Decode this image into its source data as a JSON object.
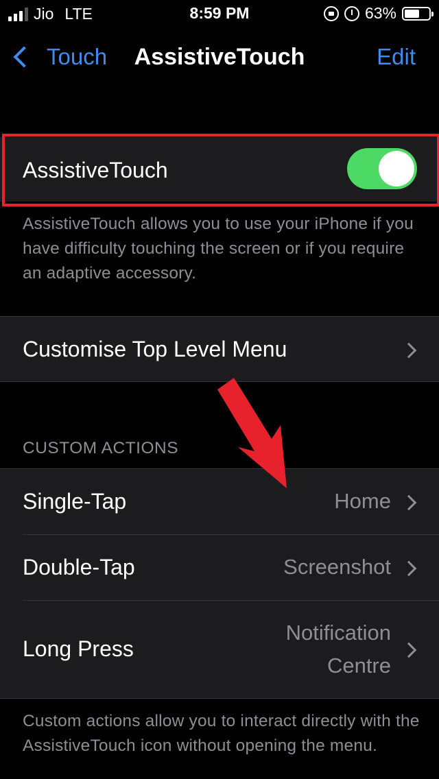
{
  "status_bar": {
    "carrier": "Jio",
    "network": "LTE",
    "time": "8:59 PM",
    "battery": "63%",
    "battery_level": 0.63,
    "signal_bars": 3
  },
  "nav": {
    "back_label": "Touch",
    "title": "AssistiveTouch",
    "edit_label": "Edit"
  },
  "assistive_touch": {
    "label": "AssistiveTouch",
    "enabled": true,
    "description": "AssistiveTouch allows you to use your iPhone if you have difficulty touching the screen or if you require an adaptive accessory."
  },
  "menu_row": {
    "label": "Customise Top Level Menu"
  },
  "custom_actions": {
    "header": "CUSTOM ACTIONS",
    "rows": [
      {
        "label": "Single-Tap",
        "value": "Home"
      },
      {
        "label": "Double-Tap",
        "value": "Screenshot"
      },
      {
        "label": "Long Press",
        "value_line1": "Notification",
        "value_line2": "Centre"
      }
    ],
    "footer": "Custom actions allow you to interact directly with the AssistiveTouch icon without opening the menu."
  },
  "colors": {
    "accent": "#3f8bf0",
    "toggle_on": "#4cd964",
    "highlight": "#e8222c",
    "cell_background": "#1c1c1e"
  }
}
